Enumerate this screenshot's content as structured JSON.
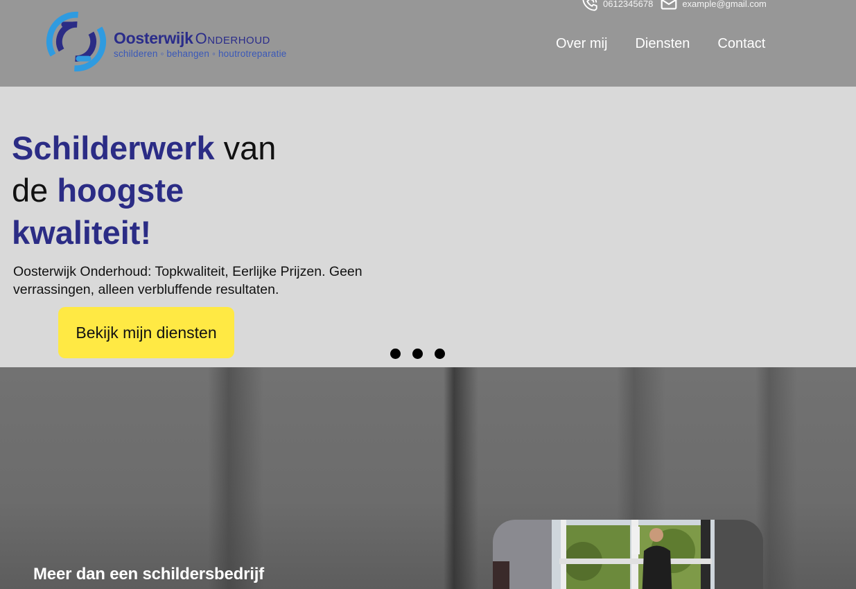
{
  "topbar": {
    "phone": "0612345678",
    "email": "example@gmail.com"
  },
  "logo": {
    "name_bold": "Oosterwijk",
    "name_light": "Onderhoud",
    "tagline": "schilderen ◦ behangen ◦ houtrotreparatie"
  },
  "nav": {
    "items": [
      {
        "label": "Over mij"
      },
      {
        "label": "Diensten"
      },
      {
        "label": "Contact"
      }
    ]
  },
  "hero": {
    "title_part1": "Schilderwerk",
    "title_part2": " van",
    "title_part3": "de ",
    "title_part4": "hoogste",
    "title_part5": "kwaliteit!",
    "subtitle": "Oosterwijk Onderhoud: Topkwaliteit, Eerlijke Prijzen. Geen verrassingen, alleen verbluffende resultaten.",
    "cta_label": "Bekijk mijn diensten",
    "slides": 3
  },
  "about": {
    "title": "Meer dan een schildersbedrijf"
  },
  "colors": {
    "brand_navy": "#2b2c85",
    "brand_blue": "#2f9be0",
    "cta_yellow": "#ffe944",
    "header_grey": "#979797",
    "hero_grey": "#d9d9d9"
  }
}
